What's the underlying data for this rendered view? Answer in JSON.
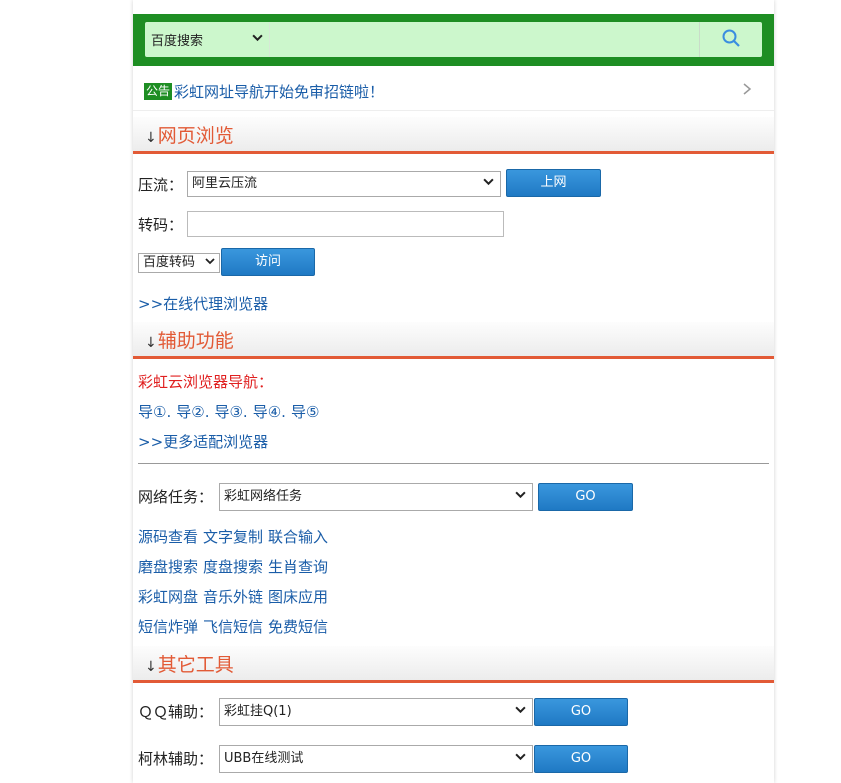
{
  "search": {
    "engine": "百度搜索",
    "input_value": ""
  },
  "notice": {
    "badge": "公告",
    "text": "彩虹网址导航开始免审招链啦！"
  },
  "sections": {
    "browse": {
      "title": "网页浏览"
    },
    "aux": {
      "title": "辅助功能"
    },
    "other": {
      "title": "其它工具"
    }
  },
  "browse": {
    "compress_label": "压流：",
    "compress_value": "阿里云压流",
    "go_online_label": "上网",
    "transcode_label": "转码：",
    "transcode_value": "",
    "transcode_engine": "百度转码",
    "visit_label": "访问",
    "proxy_link": ">>在线代理浏览器"
  },
  "aux": {
    "nav_title": "彩虹云浏览器导航：",
    "nav_links": [
      "导①",
      "导②",
      "导③",
      "导④",
      "导⑤"
    ],
    "more_link": ">>更多适配浏览器",
    "task_label": "网络任务：",
    "task_value": "彩虹网络任务",
    "task_go": "GO",
    "link_rows": [
      [
        "源码查看",
        "文字复制",
        "联合输入"
      ],
      [
        "磨盘搜索",
        "度盘搜索",
        "生肖查询"
      ],
      [
        "彩虹网盘",
        "音乐外链",
        "图床应用"
      ],
      [
        "短信炸弹",
        "飞信短信",
        "免费短信"
      ]
    ]
  },
  "other": {
    "qq_label": "ＱＱ辅助：",
    "qq_value": "彩虹挂Q(1)",
    "qq_go": "GO",
    "kelin_label": "柯林辅助：",
    "kelin_value": "UBB在线测试",
    "kelin_go": "GO"
  },
  "colors": {
    "brand_green": "#1e8e23",
    "search_bg": "#ccf7cc",
    "accent_orange": "#e25a36",
    "link_blue": "#1a5da8",
    "button_blue": "#2a86cf",
    "notice_red": "#e02020"
  },
  "icons": {
    "search": "search-icon",
    "chevron": "chevron-down-icon",
    "arrow_right": "chevron-right-icon",
    "section_arrow": "arrow-down-icon"
  }
}
